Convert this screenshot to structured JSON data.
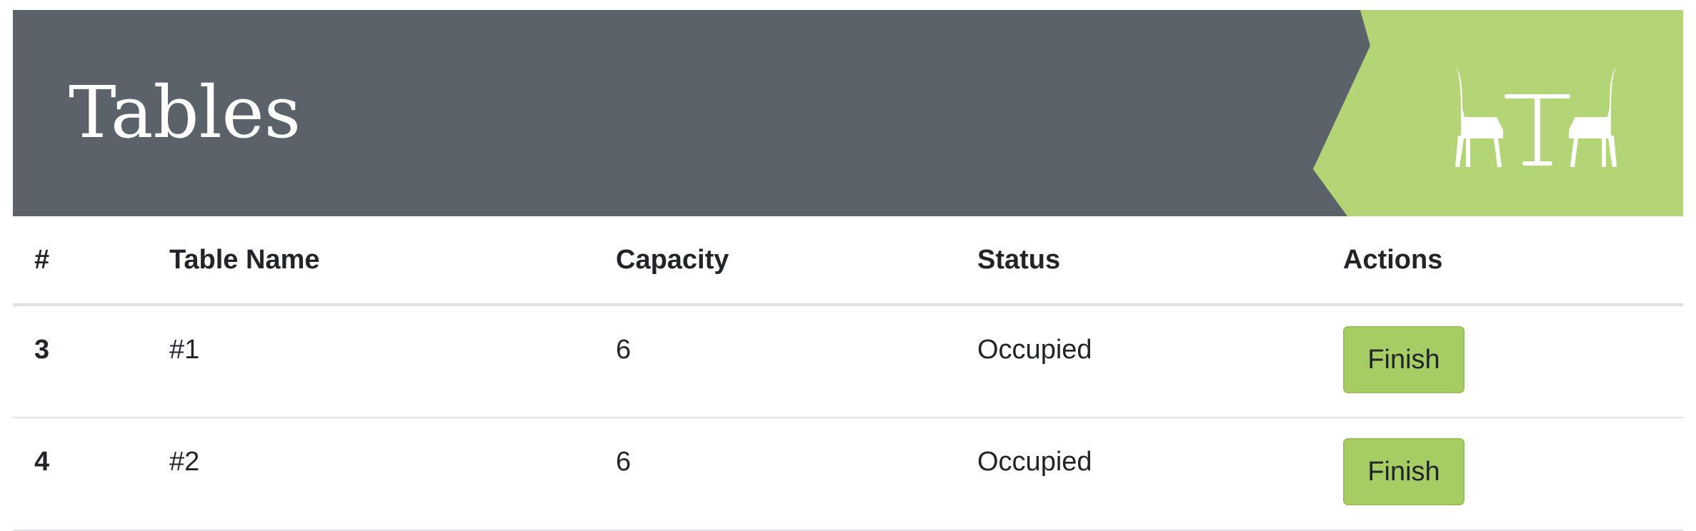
{
  "header": {
    "title": "Tables",
    "icon": "table-and-chairs-icon",
    "background_color": "#5b626a",
    "accent_color": "#b3d575"
  },
  "table": {
    "columns": [
      "#",
      "Table Name",
      "Capacity",
      "Status",
      "Actions"
    ],
    "rows": [
      {
        "id": "3",
        "name": "#1",
        "capacity": "6",
        "status": "Occupied",
        "action_label": "Finish"
      },
      {
        "id": "4",
        "name": "#2",
        "capacity": "6",
        "status": "Occupied",
        "action_label": "Finish"
      }
    ]
  },
  "colors": {
    "button_fill": "#a6cd63",
    "text": "#212529",
    "row_border": "#dee2e6"
  }
}
